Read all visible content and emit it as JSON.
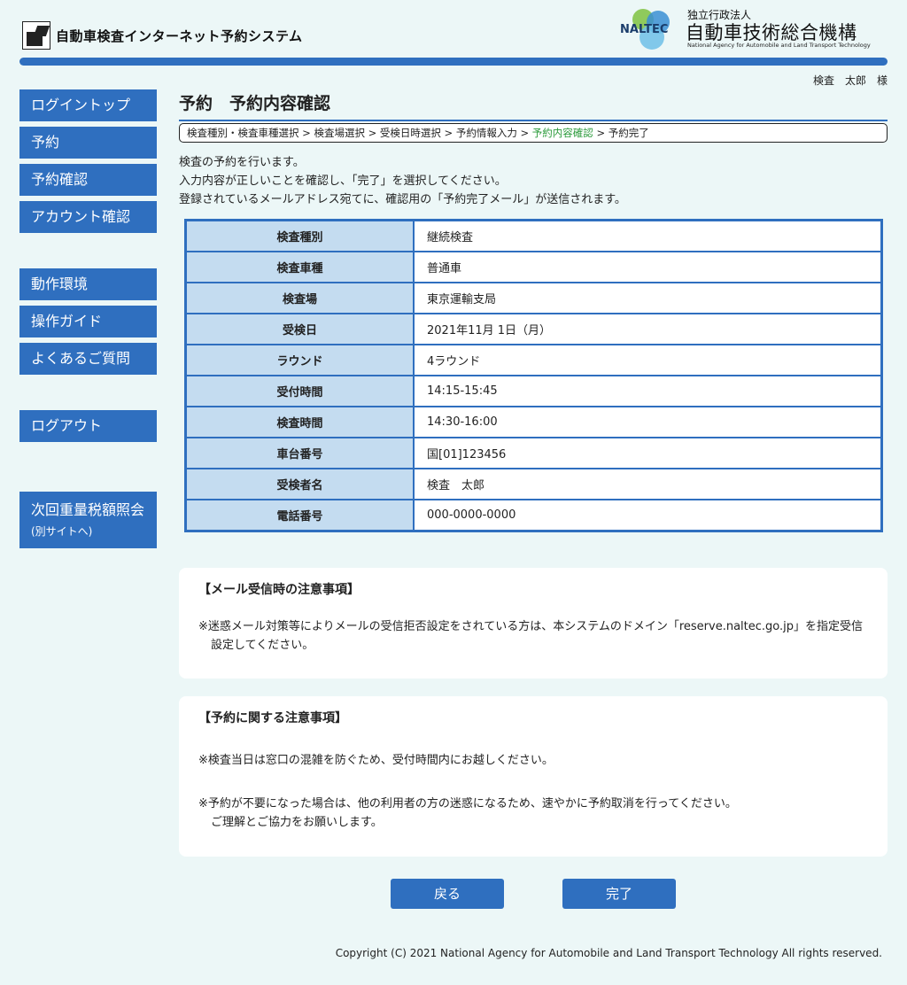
{
  "header": {
    "system_title": "自動車検査インターネット予約システム",
    "org_abbr": "NALTEC",
    "org_small": "独立行政法人",
    "org_name": "自動車技術総合機構",
    "org_en": "National Agency for Automobile and Land Transport Technology",
    "user_name": "検査　太郎　様"
  },
  "sidebar": {
    "items": [
      {
        "label": "ログイントップ"
      },
      {
        "label": "予約"
      },
      {
        "label": "予約確認"
      },
      {
        "label": "アカウント確認"
      },
      {
        "label": "動作環境"
      },
      {
        "label": "操作ガイド"
      },
      {
        "label": "よくあるご質問"
      },
      {
        "label": "ログアウト"
      },
      {
        "label": "次回重量税額照会",
        "sub": "(別サイトへ)"
      }
    ]
  },
  "page": {
    "title": "予約　予約内容確認",
    "breadcrumb": {
      "prefix": "検査種別・検査車種選択 > 検査場選択 > 受検日時選択 > 予約情報入力 > ",
      "current": "予約内容確認",
      "suffix": " > 予約完了"
    },
    "intro": [
      "検査の予約を行います。",
      "入力内容が正しいことを確認し、「完了」を選択してください。",
      "登録されているメールアドレス宛てに、確認用の「予約完了メール」が送信されます。"
    ]
  },
  "confirmation": [
    {
      "label": "検査種別",
      "value": "継続検査"
    },
    {
      "label": "検査車種",
      "value": "普通車"
    },
    {
      "label": "検査場",
      "value": "東京運輸支局"
    },
    {
      "label": "受検日",
      "value": "2021年11月 1日（月）"
    },
    {
      "label": "ラウンド",
      "value": "4ラウンド"
    },
    {
      "label": "受付時間",
      "value": "14:15-15:45"
    },
    {
      "label": "検査時間",
      "value": "14:30-16:00"
    },
    {
      "label": "車台番号",
      "value": "国[01]123456"
    },
    {
      "label": "受検者名",
      "value": "検査　太郎"
    },
    {
      "label": "電話番号",
      "value": "000-0000-0000"
    }
  ],
  "notices": {
    "mail": {
      "title": "【メール受信時の注意事項】",
      "text": "※迷惑メール対策等によりメールの受信拒否設定をされている方は、本システムのドメイン「reserve.naltec.go.jp」を指定受信設定してください。"
    },
    "reservation": {
      "title": "【予約に関する注意事項】",
      "text1": "※検査当日は窓口の混雑を防ぐため、受付時間内にお越しください。",
      "text2a": "※予約が不要になった場合は、他の利用者の方の迷惑になるため、速やかに予約取消を行ってください。",
      "text2b": "ご理解とご協力をお願いします。"
    }
  },
  "buttons": {
    "back": "戻る",
    "complete": "完了"
  },
  "footer": {
    "copyright": "Copyright (C) 2021 National Agency for Automobile and Land Transport Technology All rights reserved."
  },
  "colors": {
    "accent": "#2f6fbf",
    "background": "#ecf7f7",
    "label_cell": "#c4dcf0",
    "breadcrumb_current": "#2a9a3a"
  }
}
